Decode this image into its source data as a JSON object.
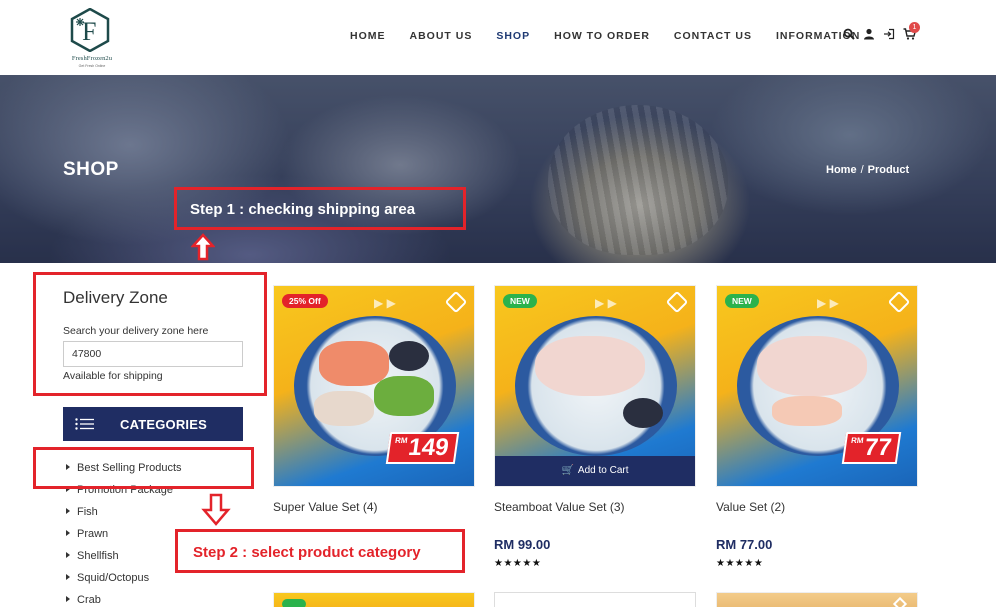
{
  "brand": {
    "logo_letter": "F",
    "name": "FreshFrozen2u",
    "tagline": "Get Fresh Online"
  },
  "nav": {
    "items": [
      "HOME",
      "ABOUT US",
      "SHOP",
      "HOW TO ORDER",
      "CONTACT US",
      "INFORMATION"
    ],
    "active": "SHOP",
    "cart_count": "1"
  },
  "hero": {
    "title": "SHOP",
    "breadcrumb": [
      "Home",
      "Product"
    ]
  },
  "annotations": {
    "step1": "Step 1 : checking shipping area",
    "step2": "Step 2 : select product category"
  },
  "delivery_zone": {
    "title": "Delivery Zone",
    "label": "Search your delivery zone here",
    "value": "47800",
    "status": "Available for shipping"
  },
  "categories": {
    "title": "CATEGORIES",
    "items": [
      "Best Selling Products",
      "Promotion Package",
      "Fish",
      "Prawn",
      "Shellfish",
      "Squid/Octopus",
      "Crab"
    ]
  },
  "products": [
    {
      "name": "Super Value Set (4)",
      "badge": "25% Off",
      "badge_type": "sale",
      "tag_currency": "RM",
      "tag_value": "149",
      "price": "",
      "rating": ""
    },
    {
      "name": "Steamboat Value Set (3)",
      "badge": "NEW",
      "badge_type": "new",
      "price": "RM 99.00",
      "rating": "★★★★★",
      "add_to_cart": "Add to Cart"
    },
    {
      "name": "Value Set (2)",
      "badge": "NEW",
      "badge_type": "new",
      "tag_currency": "RM",
      "tag_value": "77",
      "price": "RM 77.00",
      "rating": "★★★★★"
    }
  ],
  "colors": {
    "navy": "#1f2d63",
    "annotation_red": "#e3232a",
    "new_green": "#2bb24c"
  }
}
